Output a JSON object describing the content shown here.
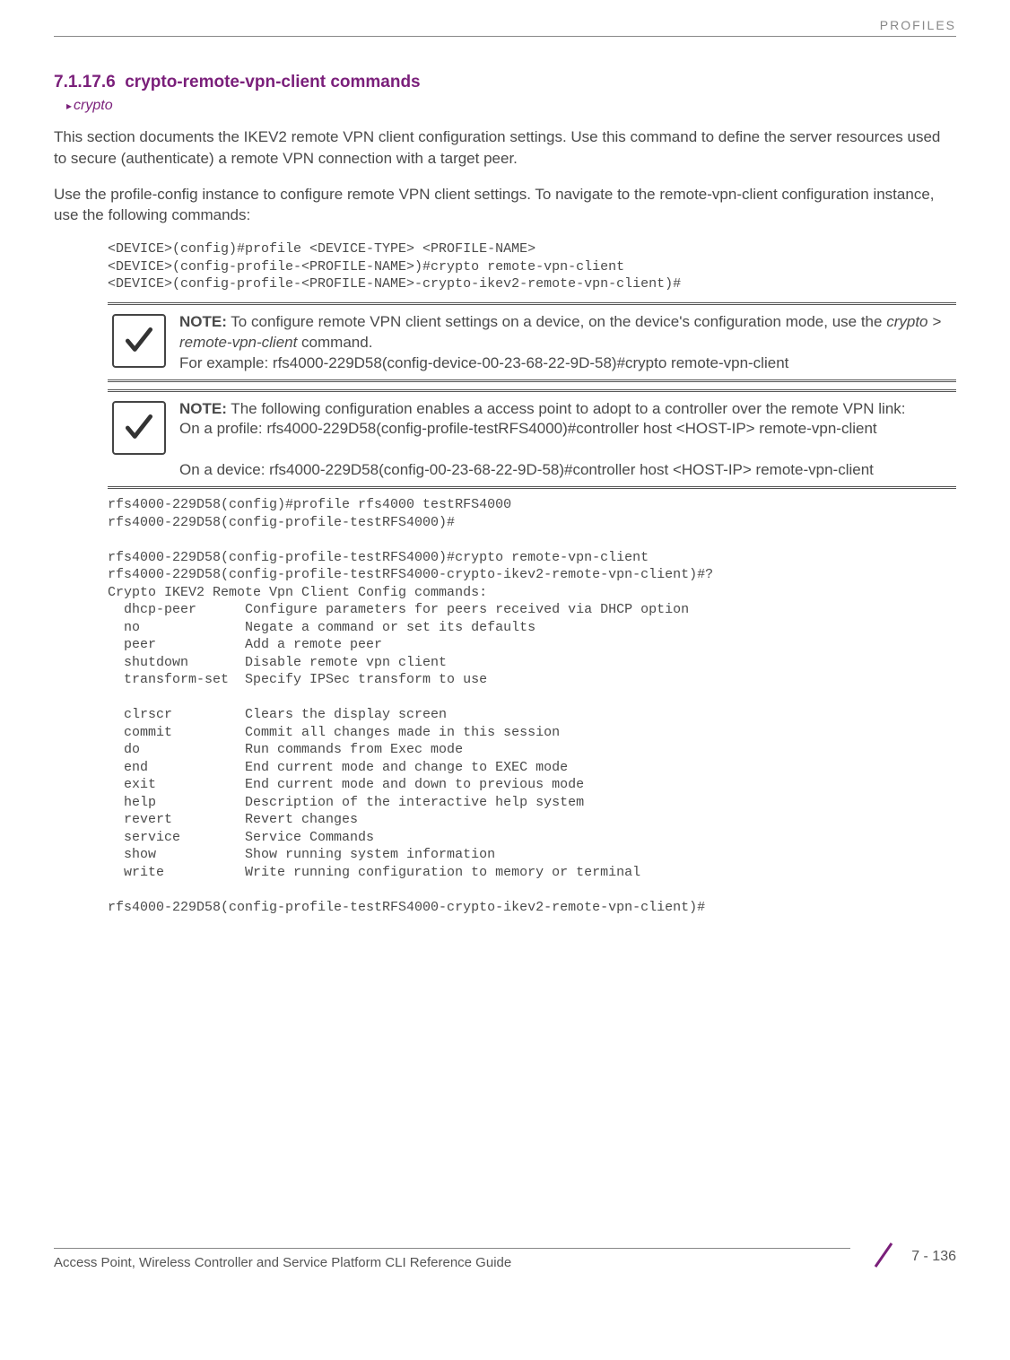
{
  "header": {
    "label": "PROFILES"
  },
  "section": {
    "number": "7.1.17.6",
    "title": "crypto-remote-vpn-client commands",
    "breadcrumb": "crypto"
  },
  "paragraphs": {
    "p1": "This section documents the IKEV2 remote VPN client configuration settings. Use this command to define the server resources used to secure (authenticate) a remote VPN connection with a target peer.",
    "p2": "Use the profile-config instance to configure remote VPN client settings. To navigate to the remote-vpn-client configuration instance, use the following commands:"
  },
  "code1": "<DEVICE>(config)#profile <DEVICE-TYPE> <PROFILE-NAME>\n<DEVICE>(config-profile-<PROFILE-NAME>)#crypto remote-vpn-client\n<DEVICE>(config-profile-<PROFILE-NAME>-crypto-ikev2-remote-vpn-client)#",
  "note1": {
    "bold": "NOTE:",
    "t1": " To configure remote VPN client settings on a device, on the device's configuration mode, use the ",
    "italic": "crypto > remote-vpn-client",
    "t2": " command.",
    "t3": "For example: rfs4000-229D58(config-device-00-23-68-22-9D-58)#crypto remote-vpn-client"
  },
  "note2": {
    "bold": "NOTE:",
    "t1": " The following configuration enables a access point to adopt to a controller over the remote VPN link:",
    "t2": "On a profile: rfs4000-229D58(config-profile-testRFS4000)#controller host <HOST-IP> remote-vpn-client",
    "t3": "On a device: rfs4000-229D58(config-00-23-68-22-9D-58)#controller host <HOST-IP> remote-vpn-client"
  },
  "code2": "rfs4000-229D58(config)#profile rfs4000 testRFS4000\nrfs4000-229D58(config-profile-testRFS4000)#\n\nrfs4000-229D58(config-profile-testRFS4000)#crypto remote-vpn-client\nrfs4000-229D58(config-profile-testRFS4000-crypto-ikev2-remote-vpn-client)#?\nCrypto IKEV2 Remote Vpn Client Config commands:\n  dhcp-peer      Configure parameters for peers received via DHCP option\n  no             Negate a command or set its defaults\n  peer           Add a remote peer\n  shutdown       Disable remote vpn client\n  transform-set  Specify IPSec transform to use\n\n  clrscr         Clears the display screen\n  commit         Commit all changes made in this session\n  do             Run commands from Exec mode\n  end            End current mode and change to EXEC mode\n  exit           End current mode and down to previous mode\n  help           Description of the interactive help system\n  revert         Revert changes\n  service        Service Commands\n  show           Show running system information\n  write          Write running configuration to memory or terminal\n\nrfs4000-229D58(config-profile-testRFS4000-crypto-ikev2-remote-vpn-client)#",
  "footer": {
    "title": "Access Point, Wireless Controller and Service Platform CLI Reference Guide",
    "page": "7 - 136"
  }
}
